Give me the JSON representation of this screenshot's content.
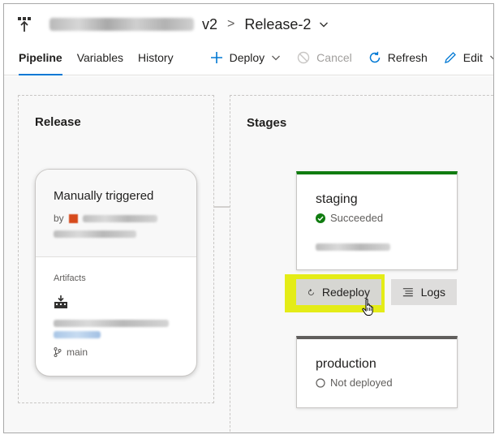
{
  "header": {
    "version_label": "v2",
    "separator": ">",
    "release_name": "Release-2"
  },
  "tabs": [
    {
      "label": "Pipeline",
      "active": true
    },
    {
      "label": "Variables",
      "active": false
    },
    {
      "label": "History",
      "active": false
    }
  ],
  "toolbar": {
    "deploy_label": "Deploy",
    "cancel_label": "Cancel",
    "refresh_label": "Refresh",
    "edit_label": "Edit"
  },
  "release_panel": {
    "title": "Release",
    "card": {
      "trigger_label": "Manually triggered",
      "by_prefix": "by",
      "artifacts_label": "Artifacts",
      "branch": "main"
    }
  },
  "stages_panel": {
    "title": "Stages",
    "stages": [
      {
        "name": "staging",
        "status": "Succeeded",
        "status_color": "#107c10"
      },
      {
        "name": "production",
        "status": "Not deployed",
        "status_color": "#605e5c"
      }
    ],
    "redeploy_label": "Redeploy",
    "logs_label": "Logs"
  },
  "colors": {
    "accent": "#0078d4",
    "success": "#107c10",
    "highlight": "#e4ec17"
  }
}
